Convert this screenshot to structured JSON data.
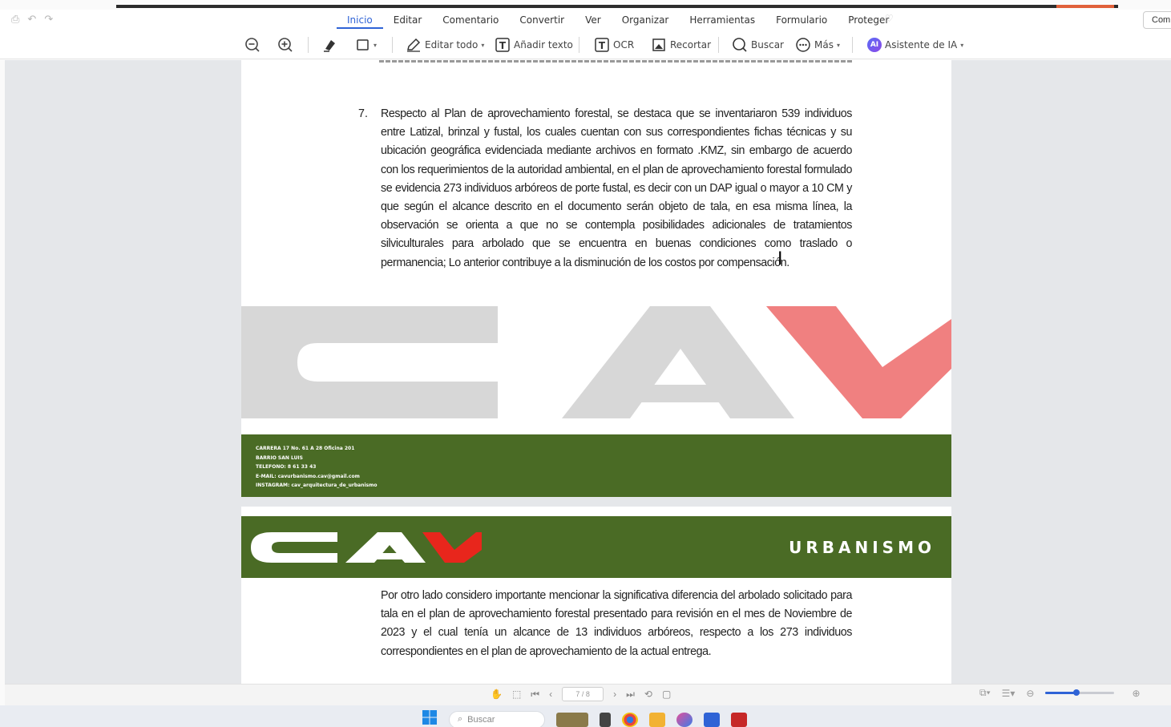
{
  "menu": {
    "tabs": [
      "Inicio",
      "Editar",
      "Comentario",
      "Convertir",
      "Ver",
      "Organizar",
      "Herramientas",
      "Formulario",
      "Proteger"
    ],
    "active_tab": "Inicio",
    "share_label": "Com"
  },
  "toolbar": {
    "edit_all": "Editar todo",
    "add_text": "Añadir texto",
    "ocr": "OCR",
    "crop": "Recortar",
    "search": "Buscar",
    "more": "Más",
    "ai_assistant": "Asistente de IA",
    "ai_badge": "AI"
  },
  "document": {
    "item_number": "7.",
    "item_text": "Respecto al Plan de aprovechamiento forestal, se destaca que se inventariaron 539 individuos entre Latizal, brinzal y fustal, los cuales cuentan con sus correspondientes fichas técnicas y su ubicación geográfica evidenciada mediante archivos en formato .KMZ, sin embargo de acuerdo con los requerimientos de la autoridad ambiental, en el plan de aprovechamiento forestal formulado se evidencia 273 individuos arbóreos de porte fustal, es decir con un DAP igual o mayor a 10 CM y que según el alcance descrito en el documento serán objeto de tala, en esa misma línea, la observación se orienta a que no se contempla posibilidades adicionales de tratamientos silviculturales para arbolado que se encuentra en buenas condiciones como traslado o permanencia; Lo anterior contribuye a la disminución de los costos por compensación.",
    "footer_lines": [
      "CARRERA 17 No. 61 A 28 Oficina 201",
      "BARRIO SAN LUIS",
      "TELEFONO: 8 61 33 43",
      "E-MAIL: cavurbanismo.cav@gmail.com",
      "INSTAGRAM: cav_arquitectura_de_urbanismo"
    ],
    "logo_text": "CAV",
    "header_label": "URBANISMO",
    "paragraph2": "Por otro lado considero importante mencionar la significativa diferencia del arbolado solicitado para tala en el plan de aprovechamiento forestal presentado para revisión en  el mes de Noviembre de 2023 y el cual tenía un alcance de 13 individuos arbóreos, respecto a los 273 individuos correspondientes en el plan de aprovechamiento de la actual entrega."
  },
  "statusbar": {
    "page_indicator": "7 / 8",
    "zoom_fraction": 0.45
  },
  "taskbar": {
    "search_placeholder": "Buscar"
  },
  "colors": {
    "accent": "#2f63d6",
    "brand_green": "#4a6b25",
    "brand_red": "#e8261c",
    "watermark_gray": "#d7d7d7",
    "watermark_red": "#f08080"
  }
}
